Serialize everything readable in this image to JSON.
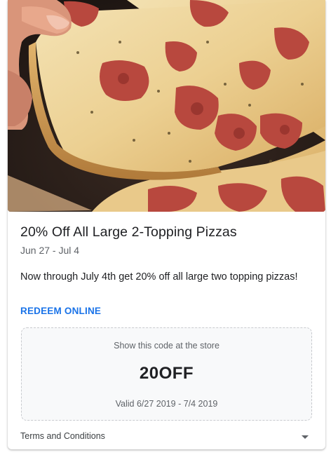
{
  "offer": {
    "title": "20% Off All Large 2-Topping Pizzas",
    "dates": "Jun 27 - Jul 4",
    "description": "Now through July 4th get 20% off all large two topping pizzas!",
    "redeem_label": "REDEEM ONLINE"
  },
  "code_box": {
    "label": "Show this code at the store",
    "code": "20OFF",
    "valid": "Valid 6/27 2019 - 7/4 2019"
  },
  "footer": {
    "terms_label": "Terms and Conditions",
    "toggle_icon": "chevron-down-icon"
  },
  "colors": {
    "link": "#1a73e8",
    "title": "#202124",
    "secondary": "#5f6368"
  }
}
